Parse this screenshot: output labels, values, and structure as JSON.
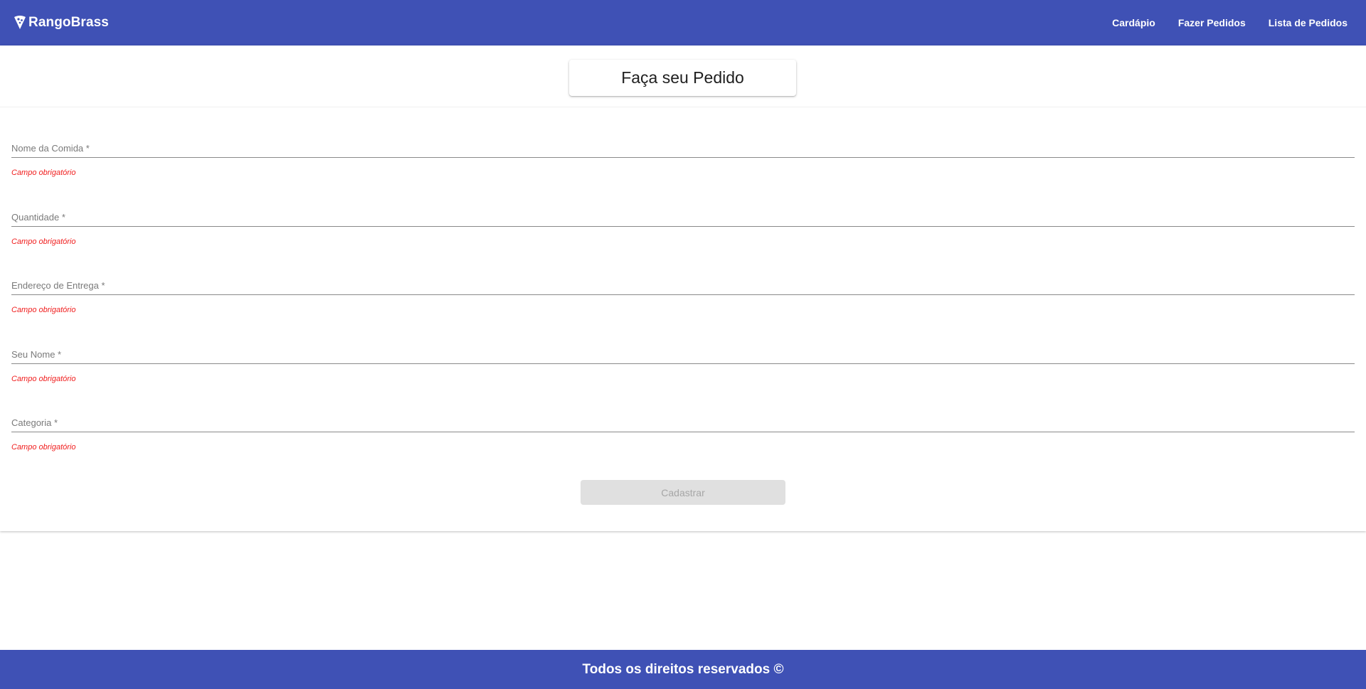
{
  "header": {
    "brand": "RangoBrass",
    "brand_icon": "pizza-slice-icon",
    "nav": [
      {
        "label": "Cardápio"
      },
      {
        "label": "Fazer Pedidos"
      },
      {
        "label": "Lista de Pedidos"
      }
    ]
  },
  "form": {
    "title": "Faça seu Pedido",
    "fields": [
      {
        "label": "Nome da Comida *",
        "value": "",
        "error": "Campo obrigatório"
      },
      {
        "label": "Quantidade *",
        "value": "",
        "error": "Campo obrigatório"
      },
      {
        "label": "Endereço de Entrega *",
        "value": "",
        "error": "Campo obrigatório"
      },
      {
        "label": "Seu Nome *",
        "value": "",
        "error": "Campo obrigatório"
      },
      {
        "label": "Categoria *",
        "value": "",
        "error": "Campo obrigatório"
      }
    ],
    "submit_label": "Cadastrar"
  },
  "footer": {
    "text": "Todos os direitos reservados ©"
  },
  "colors": {
    "primary": "#3f51b5",
    "error": "#f01d1d",
    "disabled_bg": "#e0e0e0",
    "disabled_text": "#a6a6a6"
  }
}
